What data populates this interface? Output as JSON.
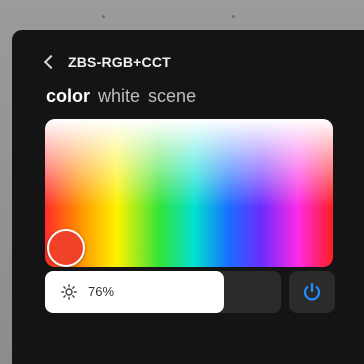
{
  "header": {
    "title": "ZBS-RGB+CCT"
  },
  "tabs": [
    {
      "label": "color",
      "active": true
    },
    {
      "label": "white",
      "active": false
    },
    {
      "label": "scene",
      "active": false
    }
  ],
  "color_picker": {
    "selected_color": "#f04228"
  },
  "brightness": {
    "value_label": "76%",
    "level_percent": 76
  },
  "icons": {
    "back": "chevron-left-icon",
    "brightness": "sun-icon",
    "power": "power-icon"
  },
  "colors": {
    "accent": "#1e8fff",
    "background": "#141414",
    "track": "#2b2b2b"
  }
}
